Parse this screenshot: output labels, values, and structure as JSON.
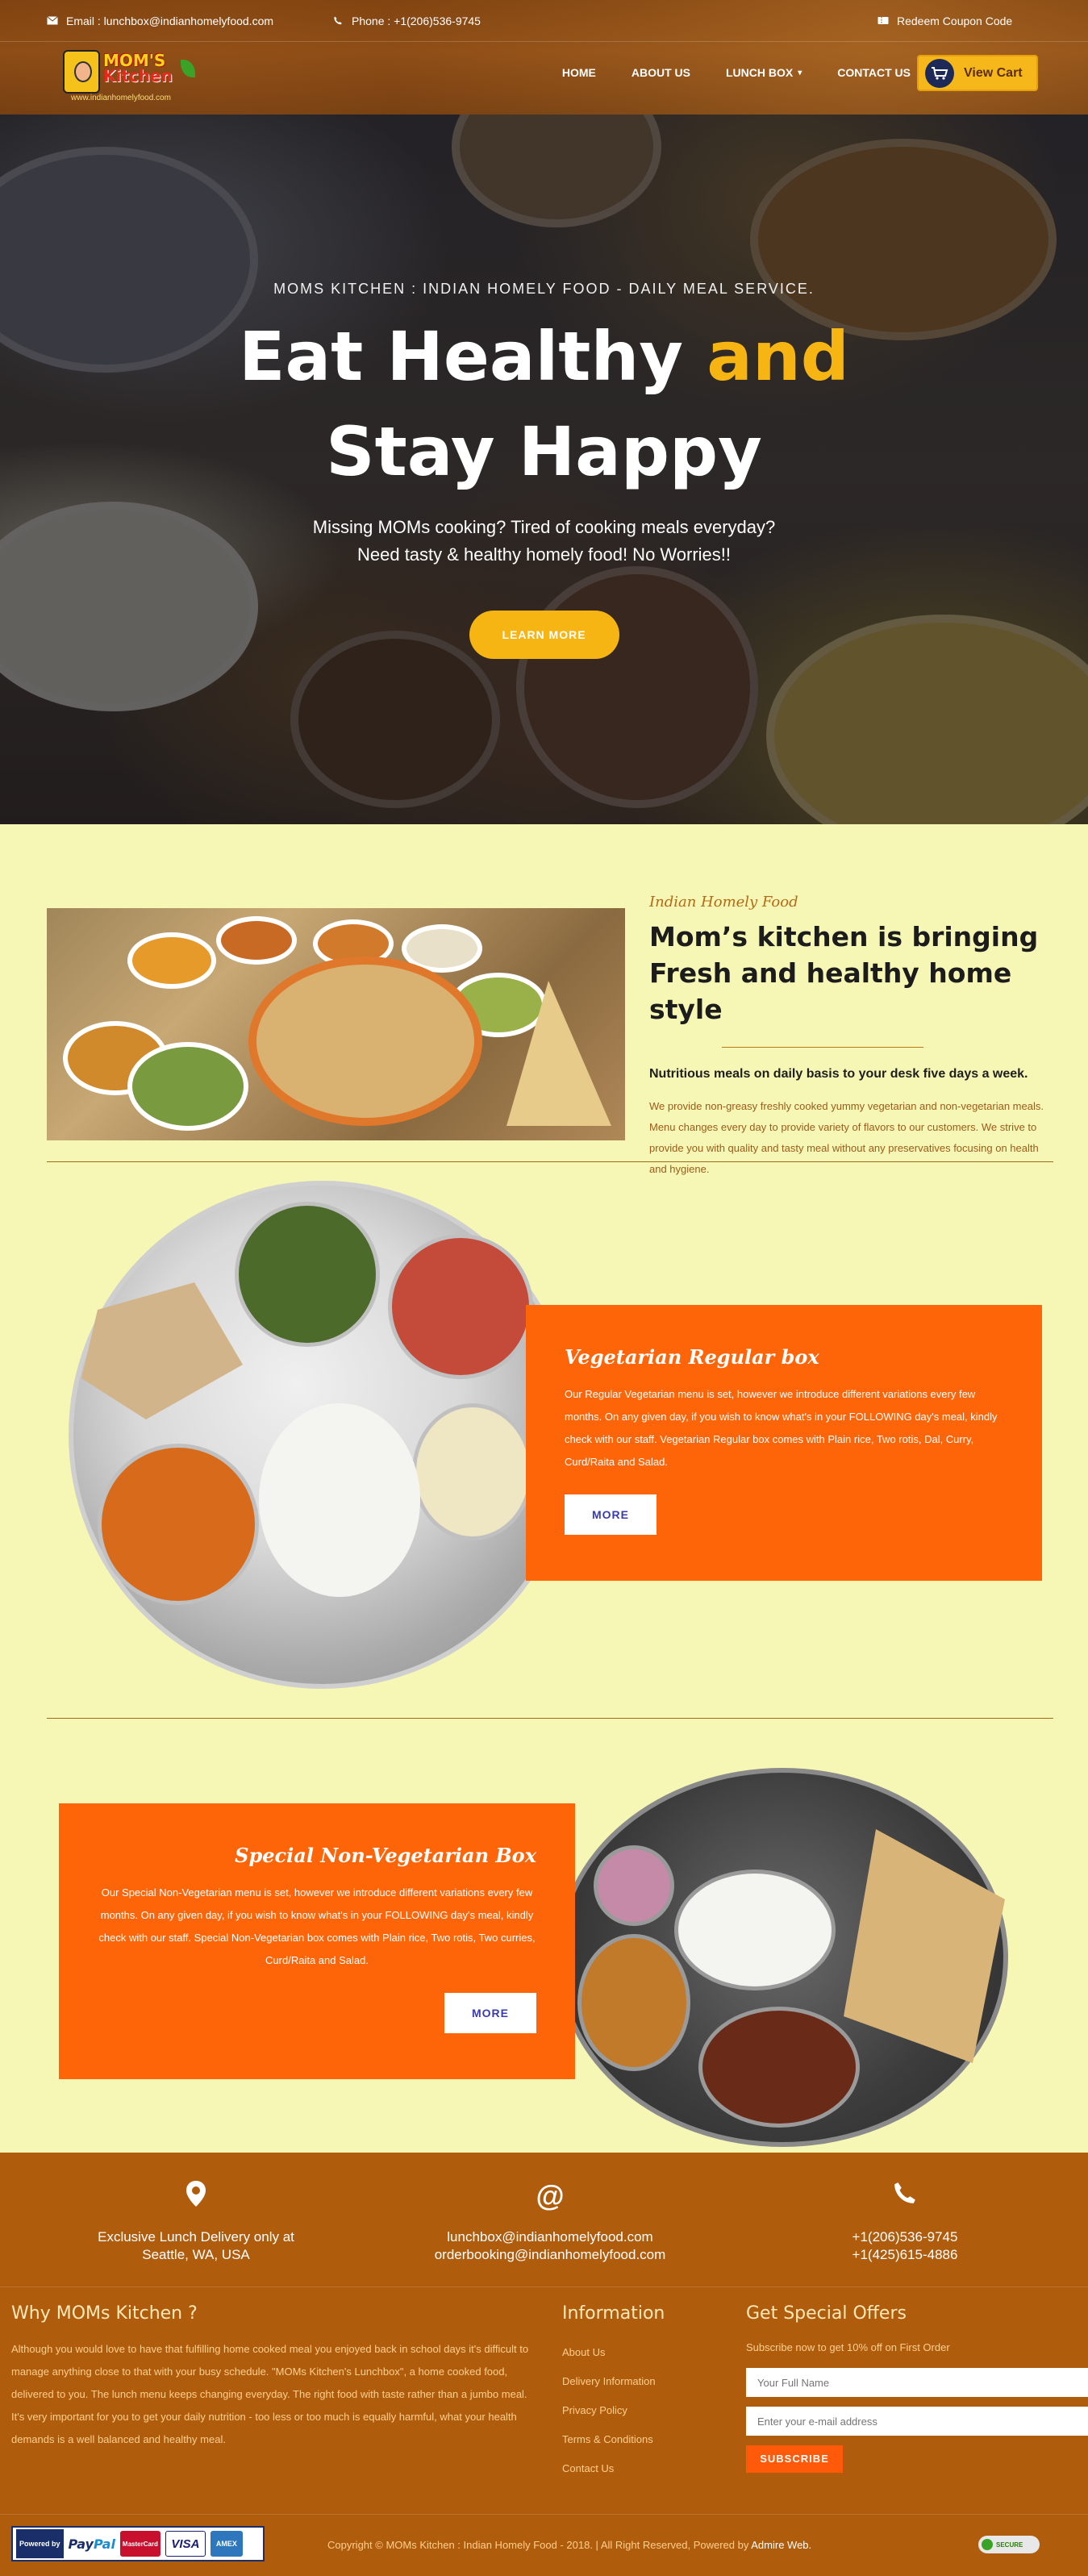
{
  "topbar": {
    "email": "Email : lunchbox@indianhomelyfood.com",
    "phone": "Phone : +1(206)536-9745",
    "coupon": "Redeem Coupon Code"
  },
  "logo": {
    "word1": "MOM'S",
    "word2": "Kitchen",
    "url": "www.indianhomelyfood.com"
  },
  "nav": {
    "items": [
      {
        "label": "HOME"
      },
      {
        "label": "ABOUT US"
      },
      {
        "label": "LUNCH BOX"
      },
      {
        "label": "CONTACT US"
      }
    ],
    "cart_label": "View Cart"
  },
  "hero": {
    "tag": "MOMS KITCHEN : INDIAN HOMELY FOOD - DAILY MEAL SERVICE.",
    "title_part1": "Eat Healthy ",
    "title_accent": "and",
    "title_line2": "Stay Happy",
    "sub_line1": "Missing MOMs cooking? Tired of cooking meals everyday?",
    "sub_line2": "Need tasty & healthy homely food! No Worries!!",
    "button": "LEARN MORE",
    "accent_color": "#f7b514"
  },
  "intro": {
    "script": "Indian Homely Food",
    "title": "Mom’s kitchen is bringing Fresh and healthy home style",
    "lead": "Nutritious meals on daily basis to your desk five days a week.",
    "body": "We provide non-greasy freshly cooked yummy vegetarian and non-vegetarian meals. Menu changes every day to provide variety of flavors to our customers. We strive to provide you with quality and tasty meal without any preservatives focusing on health and hygiene."
  },
  "veg": {
    "title": "Vegetarian Regular box",
    "text": "Our Regular Vegetarian menu is set, however we introduce different variations every few months. On any given day, if you wish to know what's in your FOLLOWING day's meal, kindly check with our staff. Vegetarian Regular box comes with Plain rice, Two rotis, Dal, Curry, Curd/Raita and Salad.",
    "button": "MORE",
    "box_color": "#fe6509"
  },
  "nonveg": {
    "title": "Special Non-Vegetarian Box",
    "text": "Our Special Non-Vegetarian menu is set, however we introduce different variations every few months. On any given day, if you wish to know what's in your FOLLOWING day's meal, kindly check with our staff. Special Non-Vegetarian box comes with Plain rice, Two rotis, Two curries, Curd/Raita and Salad.",
    "button": "MORE"
  },
  "contact": {
    "location_line1": "Exclusive Lunch Delivery only at",
    "location_line2": "Seattle, WA, USA",
    "email1": "lunchbox@indianhomelyfood.com",
    "email2": "orderbooking@indianhomelyfood.com",
    "phone1": "+1(206)536-9745",
    "phone2": "+1(425)615-4886",
    "at_icon": "@"
  },
  "footer": {
    "why_title": "Why MOMs Kitchen ?",
    "why_text": "Although you would love to have that fulfilling home cooked meal you enjoyed back in school days it's difficult to manage anything close to that with your busy schedule. \"MOMs Kitchen's Lunchbox\", a home cooked food, delivered to you. The lunch menu keeps changing everyday. The right food with taste rather than a jumbo meal. It's very important for you to get your daily nutrition - too less or too much is equally harmful, what your health demands is a well balanced and healthy meal.",
    "info_title": "Information",
    "info_links": [
      "About Us",
      "Delivery Information",
      "Privacy Policy",
      "Terms & Conditions",
      "Contact Us"
    ],
    "offer_title": "Get Special Offers",
    "offer_sub": "Subscribe now to get 10% off on First Order",
    "name_placeholder": "Your Full Name",
    "email_placeholder": "Enter your e-mail address",
    "subscribe": "SUBSCRIBE"
  },
  "bottom": {
    "powered_by": "Powered by",
    "paypal_pay": "Pay",
    "paypal_pal": "Pal",
    "card_mc": "MasterCard",
    "card_visa": "VISA",
    "card_amex": "AMEX",
    "copyright": "Copyright © MOMs Kitchen : Indian Homely Food - 2018. | All Right Reserved, Powered by ",
    "admire": "Admire Web.",
    "secure": "SECURE"
  }
}
